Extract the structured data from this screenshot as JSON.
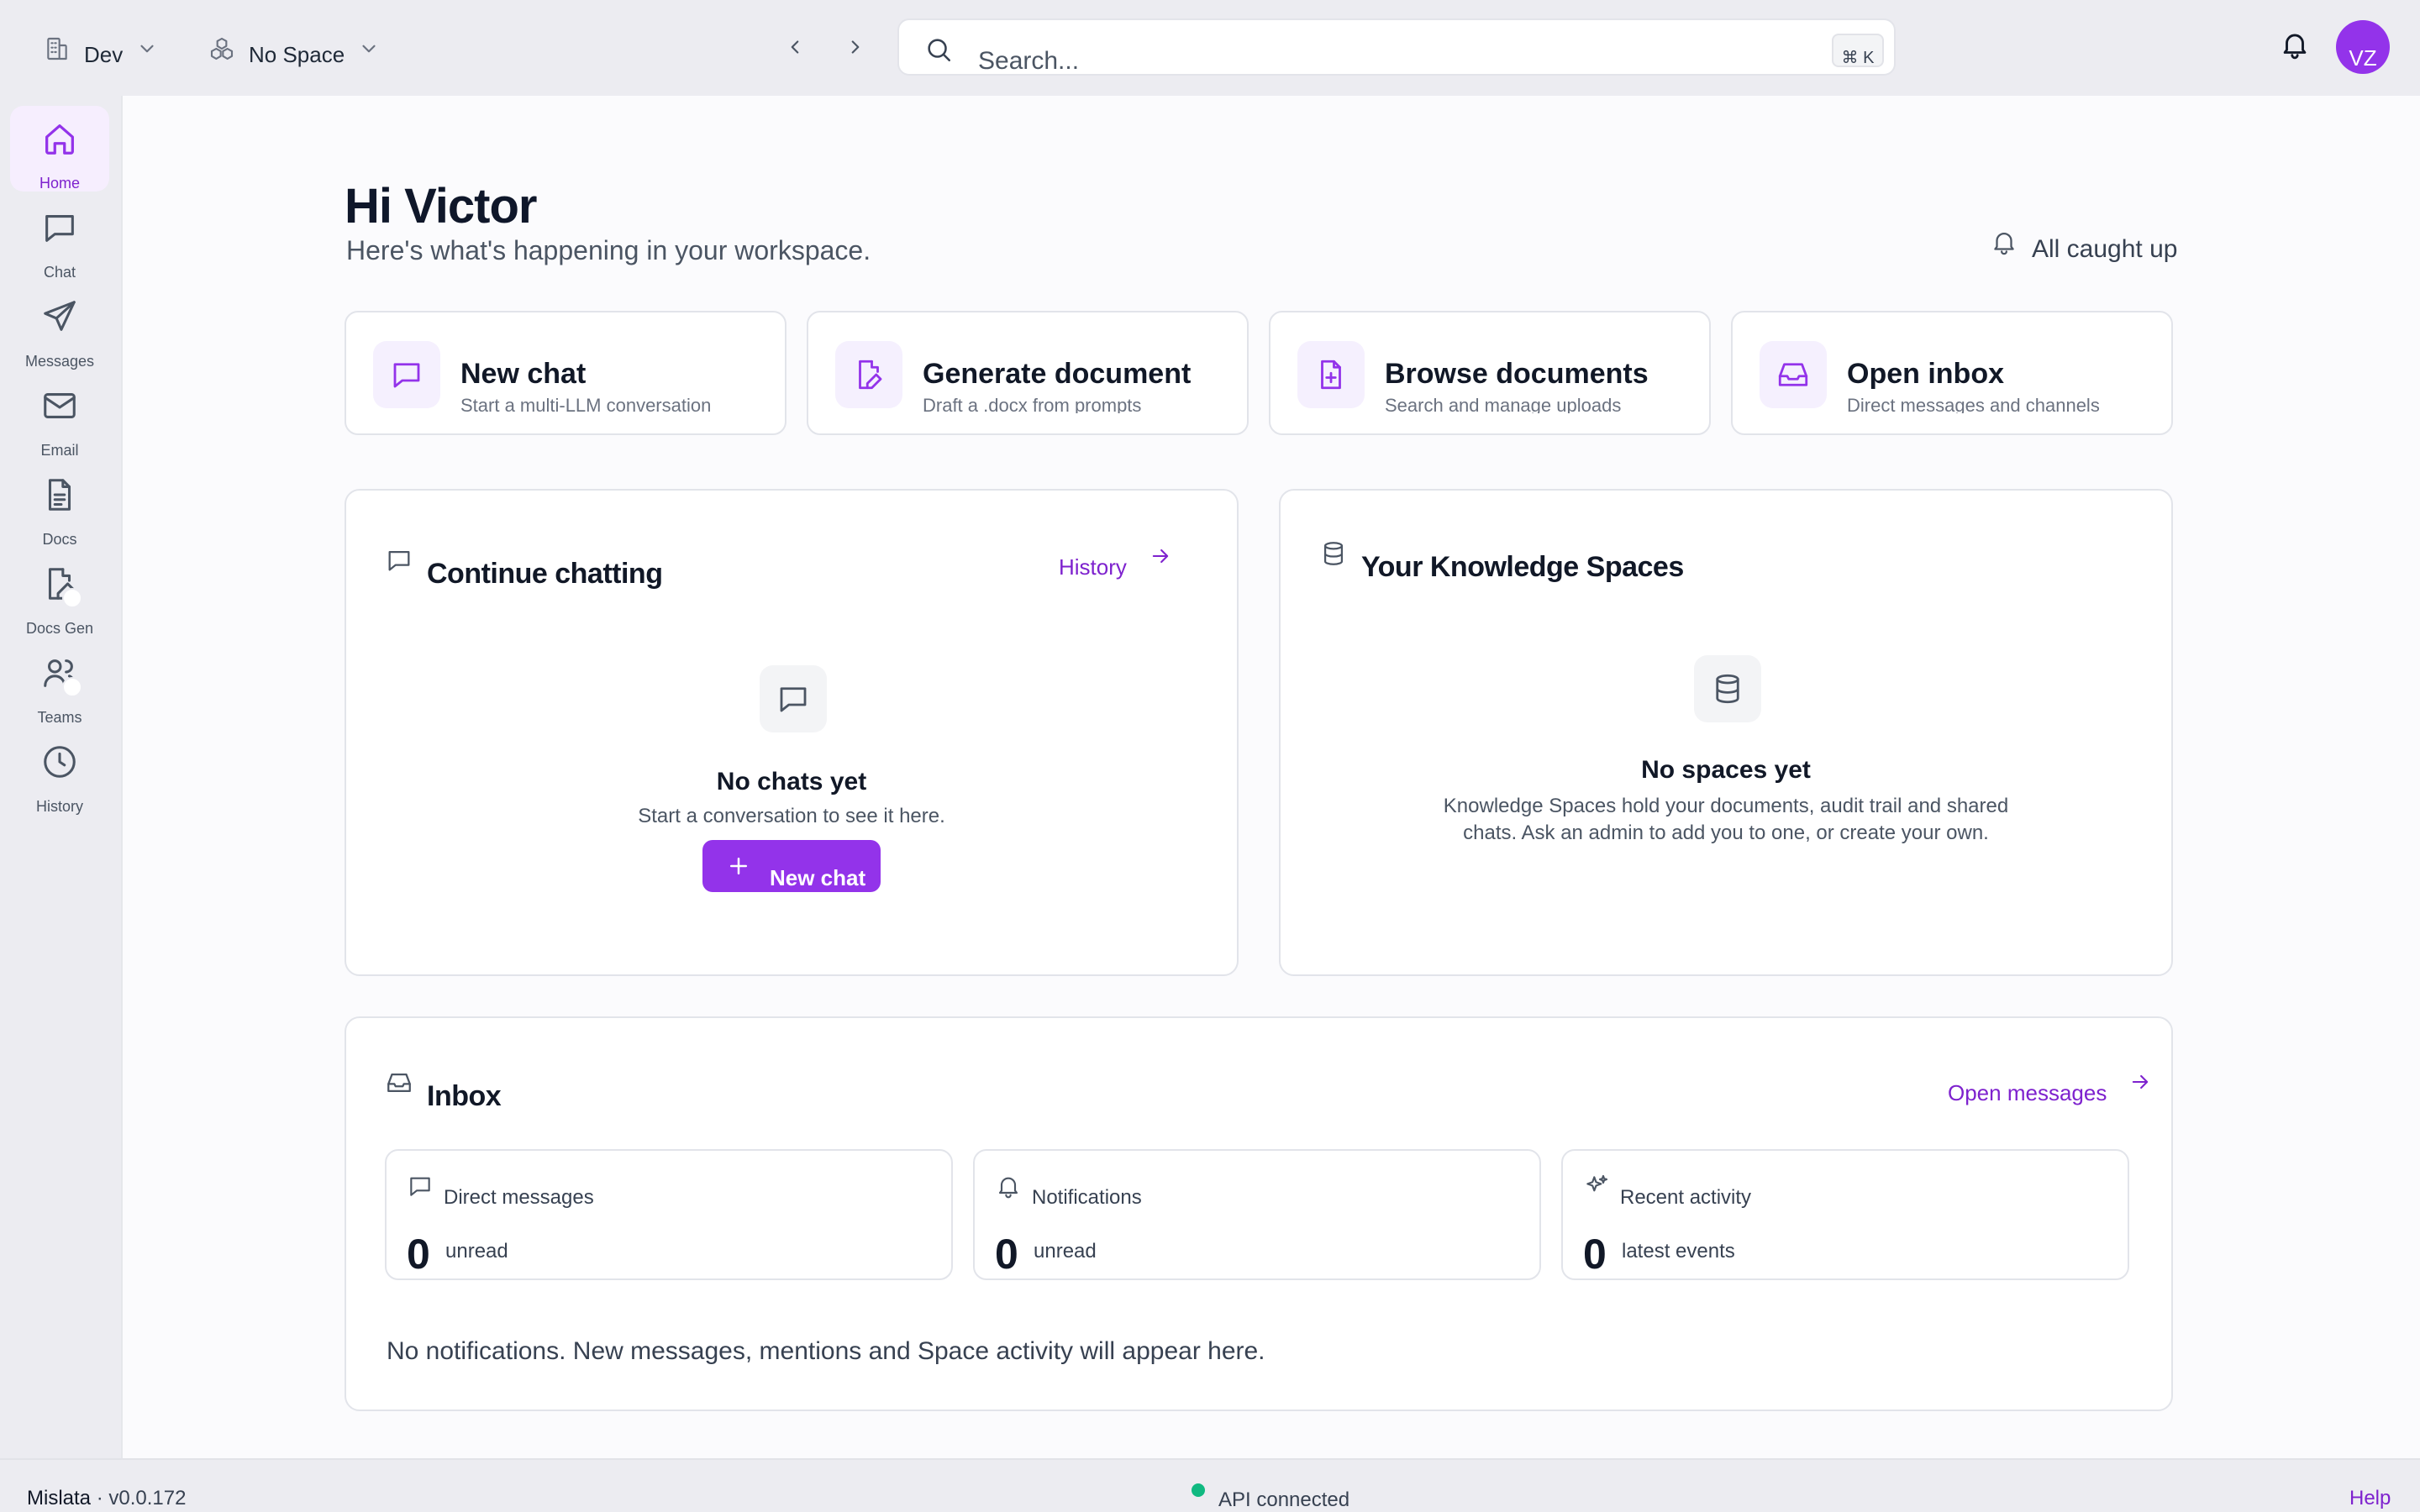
{
  "topbar": {
    "org_selector": "Dev",
    "space_selector": "No Space",
    "search_placeholder": "Search...",
    "search_shortcut": "⌘ K",
    "avatar_initials": "VZ"
  },
  "sidebar": {
    "items": [
      {
        "label": "Home",
        "icon": "home-icon"
      },
      {
        "label": "Chat",
        "icon": "chat-icon"
      },
      {
        "label": "Messages",
        "icon": "send-icon"
      },
      {
        "label": "Email",
        "icon": "mail-icon"
      },
      {
        "label": "Docs",
        "icon": "document-icon"
      },
      {
        "label": "Docs Gen",
        "icon": "document-edit-icon"
      },
      {
        "label": "Teams",
        "icon": "users-icon"
      },
      {
        "label": "History",
        "icon": "clock-icon"
      }
    ]
  },
  "main": {
    "greeting": "Hi Victor",
    "subtitle": "Here's what's happening in your workspace.",
    "status": "All caught up",
    "quick_actions": [
      {
        "title": "New chat",
        "desc": "Start a multi-LLM conversation",
        "icon": "chat-icon"
      },
      {
        "title": "Generate document",
        "desc": "Draft a .docx from prompts",
        "icon": "document-edit-icon"
      },
      {
        "title": "Browse documents",
        "desc": "Search and manage uploads",
        "icon": "document-plus-icon"
      },
      {
        "title": "Open inbox",
        "desc": "Direct messages and channels",
        "icon": "inbox-icon"
      }
    ],
    "chats": {
      "title": "Continue chatting",
      "link": "History",
      "empty_title": "No chats yet",
      "empty_text": "Start a conversation to see it here.",
      "button": "New chat"
    },
    "spaces": {
      "title": "Your Knowledge Spaces",
      "empty_title": "No spaces yet",
      "empty_line1": "Knowledge Spaces hold your documents, audit trail and shared",
      "empty_line2": "chats. Ask an admin to add you to one, or create your own."
    },
    "inbox": {
      "title": "Inbox",
      "link": "Open messages",
      "stats": [
        {
          "label": "Direct messages",
          "count": "0",
          "unit": "unread",
          "icon": "chat-icon"
        },
        {
          "label": "Notifications",
          "count": "0",
          "unit": "unread",
          "icon": "bell-icon"
        },
        {
          "label": "Recent activity",
          "count": "0",
          "unit": "latest events",
          "icon": "sparkles-icon"
        }
      ],
      "note": "No notifications. New messages, mentions and Space activity will appear here."
    }
  },
  "footer": {
    "brand": "Mislata",
    "version": " · v0.0.172",
    "api_status": "API connected",
    "help": "Help"
  },
  "colors": {
    "accent": "#9333ea",
    "accent_text": "#7e22ce",
    "status_ok": "#10b981"
  }
}
